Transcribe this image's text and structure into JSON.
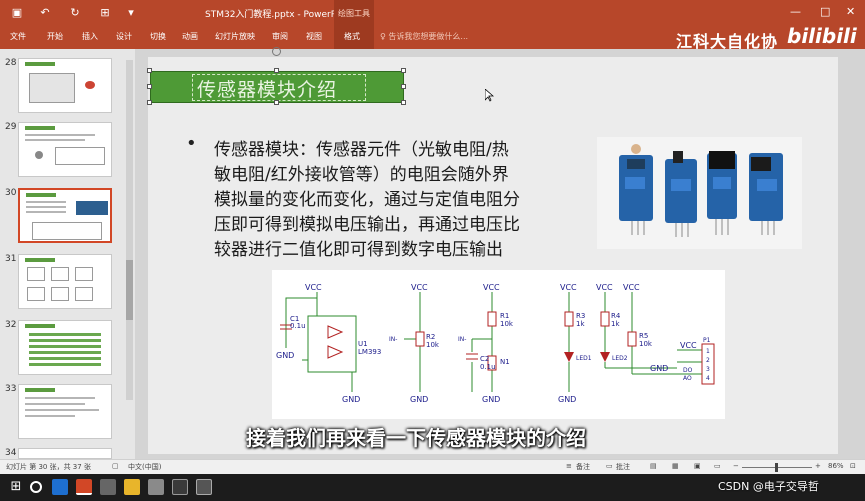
{
  "window": {
    "doc_title": "STM32入门教程.pptx - PowerPoint",
    "context_tab_group": "绘图工具"
  },
  "ribbon": {
    "tabs": [
      "文件",
      "开始",
      "插入",
      "设计",
      "切换",
      "动画",
      "幻灯片放映",
      "审阅",
      "视图",
      "格式"
    ],
    "tell_me": "告诉我您想要做什么..."
  },
  "watermark": {
    "brand": "江科大自化协",
    "bili": "bilibili"
  },
  "thumbnails": {
    "numbers": [
      "28",
      "29",
      "30",
      "31",
      "32",
      "33",
      "34"
    ],
    "active": "30"
  },
  "slide": {
    "title": "传感器模块介绍",
    "bullet": "•",
    "body_lines": [
      "传感器模块：传感器元件（光敏电阻/热",
      "敏电阻/红外接收管等）的电阻会随外界",
      "模拟量的变化而变化，通过与定值电阻分",
      "压即可得到模拟电压输出，再通过电压比",
      "较器进行二值化即可得到数字电压输出"
    ],
    "circuit_labels": {
      "vcc": "VCC",
      "gnd": "GND",
      "c1": "C1",
      "c1_val": "0.1u",
      "u1": "U1",
      "u1_part": "LM393",
      "r2": "R2",
      "r2_val": "10k",
      "in_minus": "IN-",
      "r1": "R1",
      "r1_val": "10k",
      "c2": "C2",
      "c2_val": "0.1u",
      "n1": "N1",
      "r3": "R3",
      "r3_val": "1k",
      "r4": "R4",
      "r4_val": "1k",
      "r5": "R5",
      "r5_val": "10k",
      "led1": "LED1",
      "led2": "LED2",
      "p1": "P1",
      "do": "DO",
      "ao": "AO",
      "pins": [
        "1",
        "2",
        "3",
        "4"
      ]
    }
  },
  "subtitle": "接着我们再来看一下传感器模块的介绍",
  "credit": "CSDN @电子交导哲",
  "status": {
    "slide_info": "幻灯片 第 30 张，共 37 张",
    "language": "中文(中国)",
    "notes": "备注",
    "comments": "批注",
    "zoom": "86%"
  },
  "colors": {
    "ribbon": "#b7472a",
    "title_fill": "#4e9a36",
    "active_thumb_border": "#d24726"
  }
}
